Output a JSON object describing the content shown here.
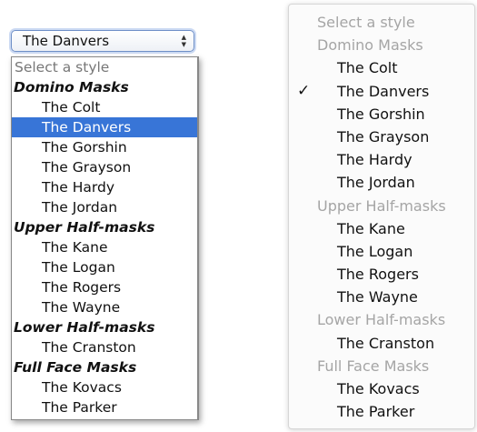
{
  "select": {
    "value": "The Danvers",
    "arrows_up": "▲",
    "arrows_down": "▼"
  },
  "listbox": {
    "placeholder": "Select a style",
    "groups": [
      {
        "label": "Domino Masks",
        "options": [
          "The Colt",
          "The Danvers",
          "The Gorshin",
          "The Grayson",
          "The Hardy",
          "The Jordan"
        ]
      },
      {
        "label": "Upper Half-masks",
        "options": [
          "The Kane",
          "The Logan",
          "The Rogers",
          "The Wayne"
        ]
      },
      {
        "label": "Lower Half-masks",
        "options": [
          "The Cranston"
        ]
      },
      {
        "label": "Full Face Masks",
        "options": [
          "The Kovacs",
          "The Parker"
        ]
      }
    ],
    "selected": "The Danvers",
    "selected_color": "#3875d7"
  },
  "menu": {
    "placeholder": "Select a style",
    "check_mark": "✓",
    "checked": "The Danvers",
    "groups": [
      {
        "label": "Domino Masks",
        "options": [
          "The Colt",
          "The Danvers",
          "The Gorshin",
          "The Grayson",
          "The Hardy",
          "The Jordan"
        ]
      },
      {
        "label": "Upper Half-masks",
        "options": [
          "The Kane",
          "The Logan",
          "The Rogers",
          "The Wayne"
        ]
      },
      {
        "label": "Lower Half-masks",
        "options": [
          "The Cranston"
        ]
      },
      {
        "label": "Full Face Masks",
        "options": [
          "The Kovacs",
          "The Parker"
        ]
      }
    ]
  }
}
